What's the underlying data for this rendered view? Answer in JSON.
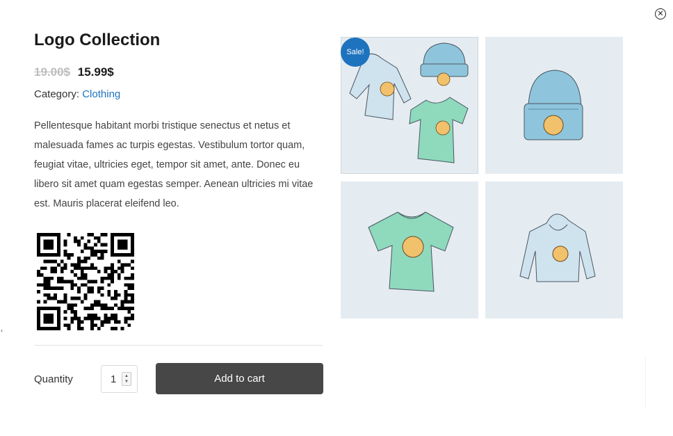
{
  "product": {
    "title": "Logo Collection",
    "old_price": "19.00$",
    "new_price": "15.99$",
    "category_label": "Category:",
    "category_value": "Clothing",
    "description": "Pellentesque habitant morbi tristique senectus et netus et malesuada fames ac turpis egestas. Vestibulum tortor quam, feugiat vitae, ultricies eget, tempor sit amet, ante. Donec eu libero sit amet quam egestas semper. Aenean ultricies mi vitae est. Mauris placerat eleifend leo."
  },
  "purchase": {
    "quantity_label": "Quantity",
    "quantity_value": "1",
    "add_to_cart_label": "Add to cart"
  },
  "gallery": {
    "sale_badge": "Sale!",
    "images": [
      "hoodie-beanie-tshirt-set",
      "beanie",
      "tshirt",
      "hoodie"
    ]
  },
  "icons": {
    "close": "close-icon",
    "stepper": "chevron-updown-icon",
    "qr": "qr-code"
  },
  "colors": {
    "accent": "#1e73be",
    "button": "#474747",
    "image_bg": "#e5ecf1",
    "beanie": "#8ec5dc",
    "tshirt": "#8fd9bd",
    "hoodie": "#cfe3ef",
    "logo": "#f2c16b"
  }
}
